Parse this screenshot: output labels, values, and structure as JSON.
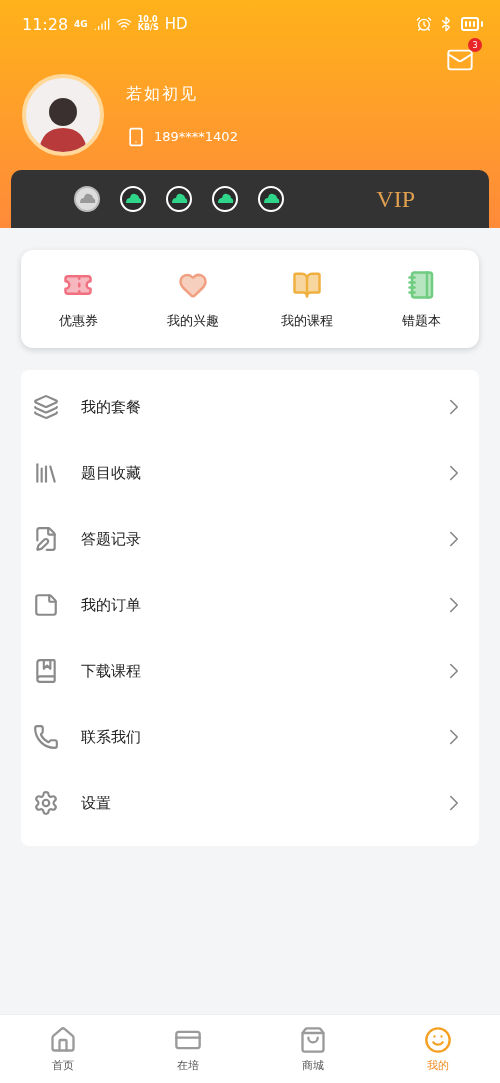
{
  "status_bar": {
    "time": "11:28",
    "network": "4G",
    "speed": "10.0",
    "speed_unit": "KB/S",
    "hd": "HD"
  },
  "header": {
    "mail_badge": "3",
    "username": "若如初见",
    "phone": "189****1402"
  },
  "vip": {
    "medals": [
      {
        "earned": false
      },
      {
        "earned": true
      },
      {
        "earned": true
      },
      {
        "earned": true
      },
      {
        "earned": true
      }
    ],
    "label": "VIP"
  },
  "shortcuts": [
    {
      "label": "优惠券"
    },
    {
      "label": "我的兴趣"
    },
    {
      "label": "我的课程"
    },
    {
      "label": "错题本"
    }
  ],
  "menu": [
    {
      "label": "我的套餐"
    },
    {
      "label": "题目收藏"
    },
    {
      "label": "答题记录"
    },
    {
      "label": "我的订单"
    },
    {
      "label": "下载课程"
    },
    {
      "label": "联系我们"
    },
    {
      "label": "设置"
    }
  ],
  "tabs": [
    {
      "label": "首页",
      "selected": false
    },
    {
      "label": "在培",
      "selected": false
    },
    {
      "label": "商城",
      "selected": false
    },
    {
      "label": "我的",
      "selected": true
    }
  ]
}
